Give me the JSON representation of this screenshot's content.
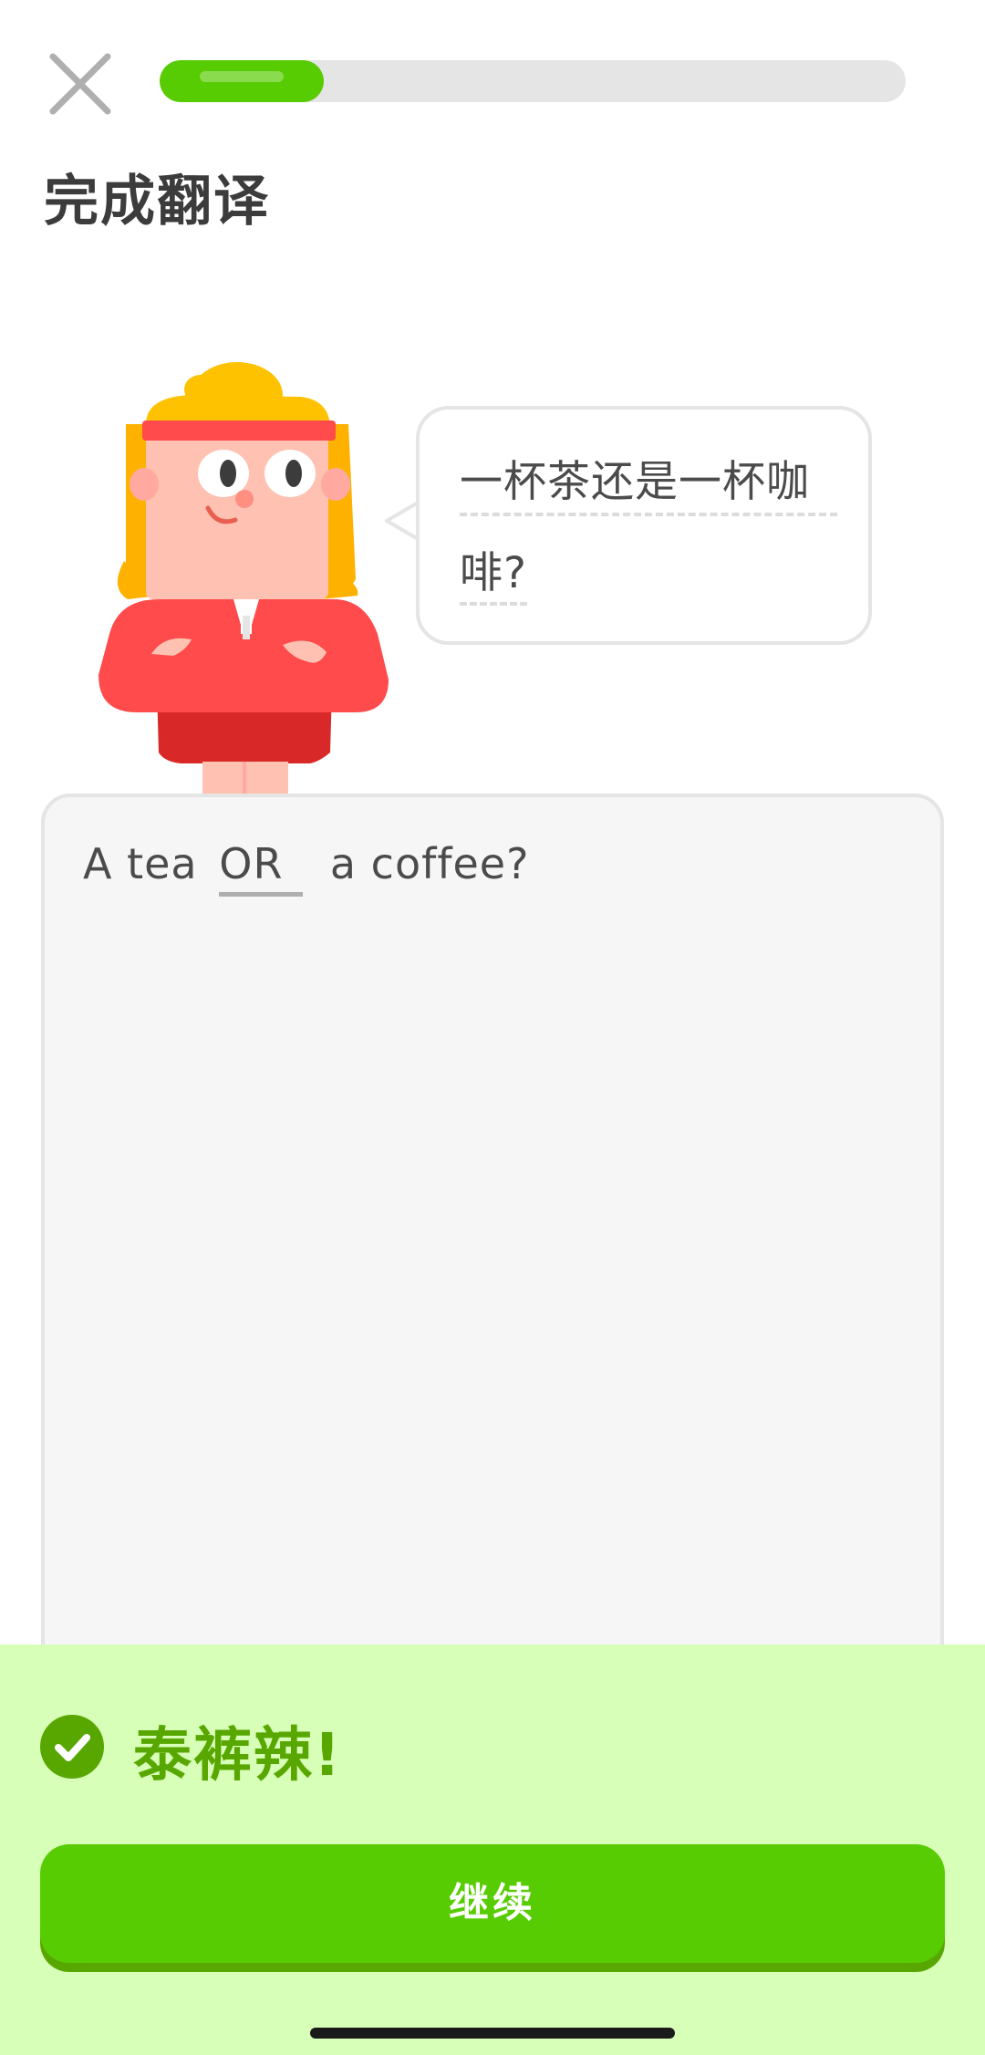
{
  "header": {
    "close_icon": "close-icon",
    "progress": 0.22,
    "progress_color": "#58cc02"
  },
  "title": "完成翻译",
  "character": {
    "icon": "lily-character-illustration"
  },
  "prompt": {
    "line1": "一杯茶还是一杯咖",
    "line2": "啡?"
  },
  "answer": {
    "before": "A tea",
    "filled_word": "OR",
    "after": "a coffee?"
  },
  "feedback": {
    "icon": "check-circle-icon",
    "title": "泰裤辣!",
    "continue_label": "继续",
    "accent": "#58cc02",
    "text_color": "#58a700",
    "background": "#d7ffb8"
  }
}
